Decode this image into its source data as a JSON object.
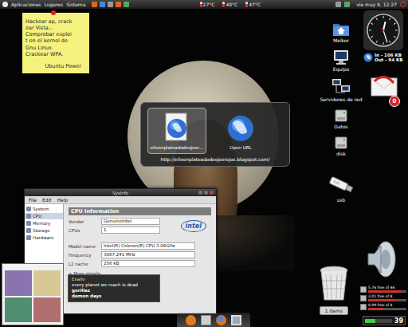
{
  "top_panel": {
    "menus": [
      "Aplicaciones",
      "Lugares",
      "Sistema"
    ],
    "temperatures": [
      "27°C",
      "40°C",
      "47°C"
    ],
    "clock": "vie may 9, 12:27"
  },
  "sticky_note": {
    "lines": [
      "Hackear ap, crack",
      "ear Vista...",
      "Comprobar exploi",
      "t en el kernel de",
      "Gnu Linux.",
      "Crackear WPA."
    ],
    "signature": "Ubuntu Power"
  },
  "desktop_icons": [
    {
      "label": "Melkor",
      "kind": "home"
    },
    {
      "label": "Equipo",
      "kind": "computer"
    },
    {
      "label": "Servidores de red",
      "kind": "network"
    },
    {
      "label": "Datos",
      "kind": "drive"
    },
    {
      "label": "disk",
      "kind": "drive"
    },
    {
      "label": "usb",
      "kind": "usb"
    }
  ],
  "launcher_popup": {
    "items": [
      {
        "label": "elleonplateadodeojosr…",
        "selected": true,
        "kind": "document"
      },
      {
        "label": "Open URL",
        "selected": false,
        "kind": "globe"
      }
    ],
    "query": "http://elleonplateadodeojosrojos.blogspot.com/"
  },
  "sysinfo": {
    "title": "Sysinfo",
    "menus": [
      "File",
      "Edit",
      "Help"
    ],
    "sidebar": [
      {
        "label": "System",
        "selected": false
      },
      {
        "label": "CPU",
        "selected": true
      },
      {
        "label": "Memory",
        "selected": false
      },
      {
        "label": "Storage",
        "selected": false
      },
      {
        "label": "Hardware",
        "selected": false
      }
    ],
    "heading": "CPU Information",
    "logo": "intel",
    "fields": [
      {
        "label": "Vendor",
        "value": "GenuineIntel"
      },
      {
        "label": "CPUs",
        "value": "1"
      },
      {
        "label": "Model name",
        "value": "Intel(R) Celeron(R) CPU 3.06GHz"
      },
      {
        "label": "Frequency",
        "value": "3067.241 MHz"
      },
      {
        "label": "L2 cache",
        "value": "256 KB"
      }
    ],
    "more": "+ More details"
  },
  "player": {
    "app": "Exaile",
    "track": "every planet we reach is dead",
    "artist": "gorillaz",
    "album": "demon days"
  },
  "widgets": {
    "analog_clock": {
      "hour": 12,
      "minute": 27
    },
    "network": [
      "In - 106 KB",
      "Out - 94 KB"
    ],
    "mail_count": "0",
    "trash_button": "1 items",
    "disks": [
      {
        "reading": "5,76 free of 46",
        "level": 0.85
      },
      {
        "reading": "2,01 free of 8",
        "level": 0.7
      },
      {
        "reading": "0,99 free of 4",
        "level": 0.4
      }
    ],
    "battery": {
      "reading": "39",
      "level": 0.39
    }
  }
}
